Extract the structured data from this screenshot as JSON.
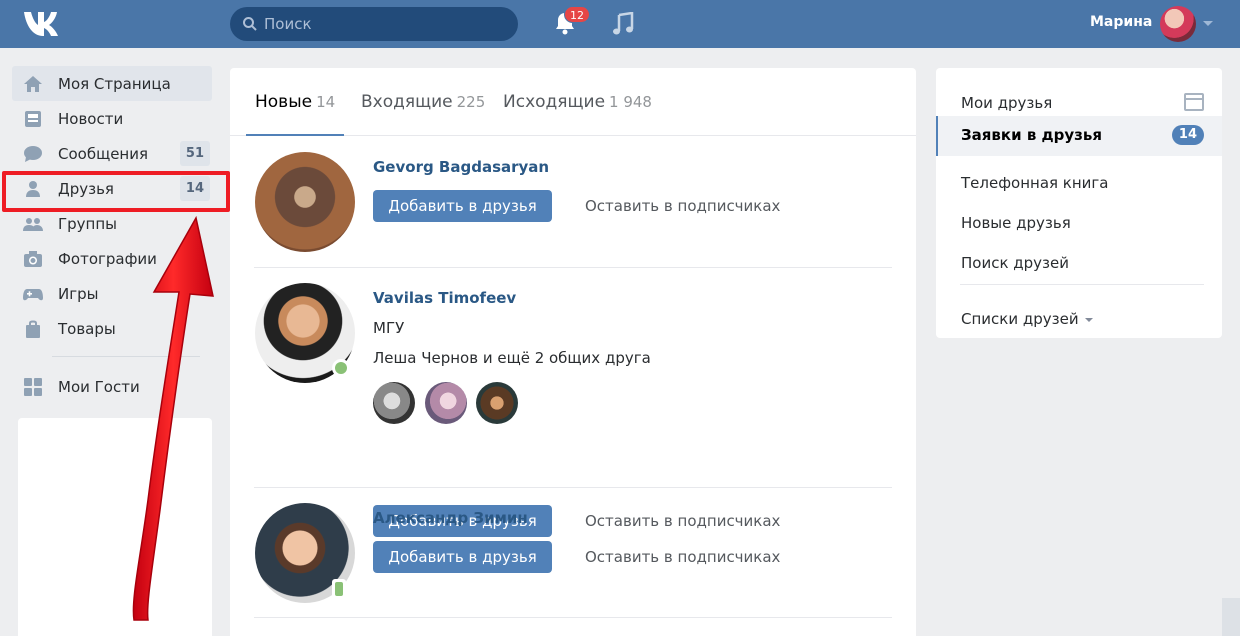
{
  "header": {
    "search_placeholder": "Поиск",
    "notifications_count": "12",
    "user_name": "Марина"
  },
  "leftnav": {
    "items": [
      {
        "label": "Моя Страница",
        "icon": "home-icon"
      },
      {
        "label": "Новости",
        "icon": "news-icon"
      },
      {
        "label": "Сообщения",
        "icon": "messages-icon",
        "count": "51"
      },
      {
        "label": "Друзья",
        "icon": "friends-icon",
        "count": "14"
      },
      {
        "label": "Группы",
        "icon": "groups-icon"
      },
      {
        "label": "Фотографии",
        "icon": "camera-icon"
      },
      {
        "label": "Игры",
        "icon": "gamepad-icon"
      },
      {
        "label": "Товары",
        "icon": "bag-icon"
      },
      {
        "label": "Мои Гости",
        "icon": "apps-icon"
      }
    ]
  },
  "tabs": [
    {
      "label": "Новые",
      "count": "14"
    },
    {
      "label": "Входящие",
      "count": "225"
    },
    {
      "label": "Исходящие",
      "count": "1 948"
    }
  ],
  "requests": [
    {
      "name": "Gevorg Bagdasaryan",
      "add_label": "Добавить в друзья",
      "keep_label": "Оставить в подписчиках"
    },
    {
      "name": "Vavilas Timofeev",
      "university": "МГУ",
      "mutual": "Леша Чернов и ещё 2 общих друга",
      "add_label": "Добавить в друзья",
      "keep_label": "Оставить в подписчиках"
    },
    {
      "name": "Александр Зимин",
      "add_label": "Добавить в друзья",
      "keep_label": "Оставить в подписчиках"
    }
  ],
  "right": {
    "items": [
      {
        "label": "Мои друзья"
      },
      {
        "label": "Заявки в друзья",
        "count": "14"
      },
      {
        "label": "Телефонная книга"
      },
      {
        "label": "Новые друзья"
      },
      {
        "label": "Поиск друзей"
      },
      {
        "label": "Списки друзей"
      }
    ]
  },
  "colors": {
    "header": "#4a76a8",
    "link": "#2a5885",
    "button": "#5181b8",
    "annotation": "#ee1c24"
  }
}
